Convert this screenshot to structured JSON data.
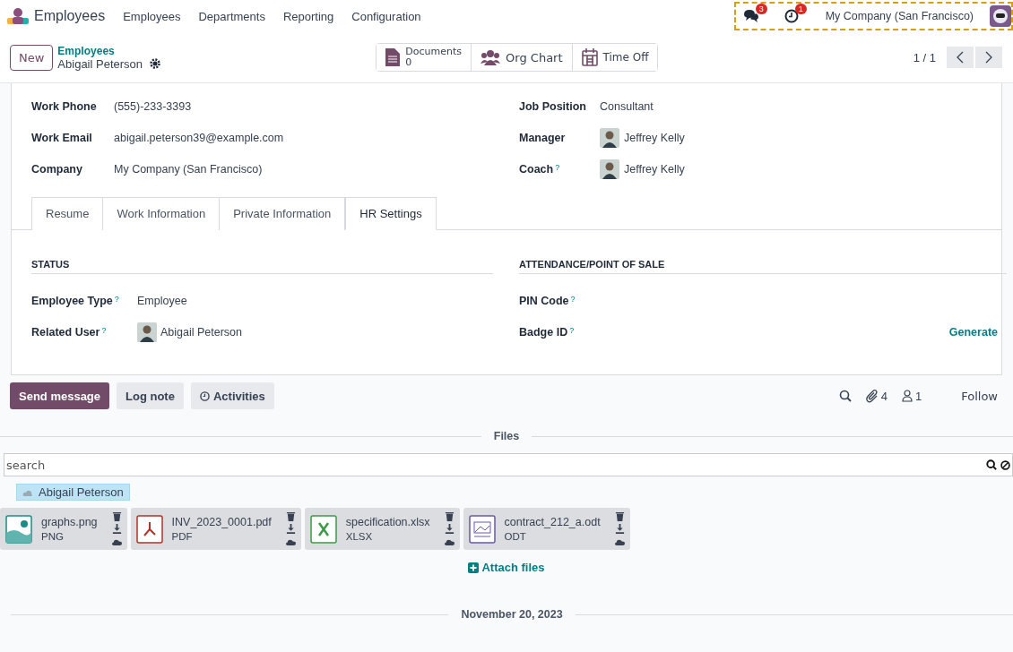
{
  "navbar": {
    "app": "Employees",
    "menu": [
      "Employees",
      "Departments",
      "Reporting",
      "Configuration"
    ],
    "messages_badge": "3",
    "activities_badge": "1",
    "company": "My Company (San Francisco)"
  },
  "control_panel": {
    "new_button": "New",
    "breadcrumb": "Employees",
    "record": "Abigail Peterson",
    "smart_buttons": [
      {
        "kind": "documents",
        "label": "Documents",
        "value": "0"
      },
      {
        "kind": "orgchart",
        "label": "Org Chart"
      },
      {
        "kind": "timeoff",
        "label": "Time Off"
      }
    ],
    "pager": "1 / 1"
  },
  "form": {
    "left_fields": [
      {
        "label": "Work Phone",
        "value": "(555)-233-3393"
      },
      {
        "label": "Work Email",
        "value": "abigail.peterson39@example.com"
      },
      {
        "label": "Company",
        "value": "My Company (San Francisco)"
      }
    ],
    "right_fields": [
      {
        "label": "Job Position",
        "value": "Consultant",
        "avatar": false
      },
      {
        "label": "Manager",
        "value": "Jeffrey Kelly",
        "avatar": true
      },
      {
        "label": "Coach",
        "help": "?",
        "value": "Jeffrey Kelly",
        "avatar": true
      }
    ],
    "tabs": [
      {
        "label": "Resume",
        "selected": false
      },
      {
        "label": "Work Information",
        "selected": false
      },
      {
        "label": "Private Information",
        "selected": false
      },
      {
        "label": "HR Settings",
        "selected": true
      }
    ],
    "status": {
      "title": "STATUS",
      "fields": [
        {
          "label": "Employee Type",
          "help": "?",
          "value": "Employee",
          "avatar": false
        },
        {
          "label": "Related User",
          "help": "?",
          "value": "Abigail Peterson",
          "avatar": true
        }
      ]
    },
    "attendance": {
      "title": "ATTENDANCE/POINT OF SALE",
      "fields": [
        {
          "label": "PIN Code",
          "help": "?"
        },
        {
          "label": "Badge ID",
          "help": "?",
          "action": "Generate"
        }
      ]
    }
  },
  "chatter": {
    "buttons": [
      {
        "label": "Send message",
        "selected": true,
        "icon": false
      },
      {
        "label": "Log note",
        "selected": false,
        "icon": false
      },
      {
        "label": "Activities",
        "selected": false,
        "icon": true
      }
    ],
    "attachments": "4",
    "followers": "1",
    "follow": "Follow",
    "files_title": "Files",
    "search": {
      "placeholder": "search"
    },
    "folder": "Abigail Peterson",
    "files": [
      {
        "kind": "image",
        "name": "graphs.png",
        "type": "PNG"
      },
      {
        "kind": "pdf",
        "name": "INV_2023_0001.pdf",
        "type": "PDF"
      },
      {
        "kind": "sheet",
        "name": "specification.xlsx",
        "type": "XLSX"
      },
      {
        "kind": "doc",
        "name": "contract_212_a.odt",
        "type": "ODT"
      }
    ],
    "attach": "Attach files",
    "date": "November 20, 2023"
  }
}
